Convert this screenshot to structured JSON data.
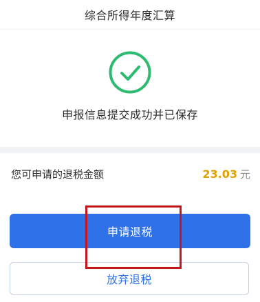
{
  "header": {
    "title": "综合所得年度汇算"
  },
  "status": {
    "icon": "check-circle-icon",
    "message": "申报信息提交成功并已保存",
    "accent_color": "#2dbb70"
  },
  "refund": {
    "label": "您可申请的退税金额",
    "amount": "23.03",
    "unit": "元",
    "amount_color": "#e0a100"
  },
  "actions": {
    "apply_label": "申请退税",
    "abandon_label": "放弃退税",
    "primary_color": "#2f72e8"
  },
  "annotation": {
    "highlight_color": "#c4161c"
  }
}
